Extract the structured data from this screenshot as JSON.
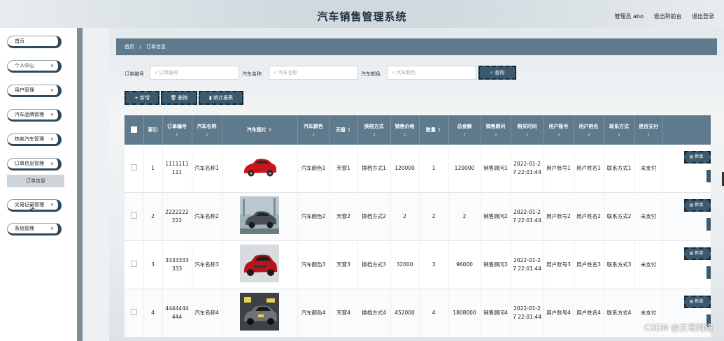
{
  "header": {
    "title": "汽车销售管理系统",
    "admin": "管理员 abo",
    "back_front": "退出到前台",
    "logout": "退出登录"
  },
  "sidebar": {
    "items": [
      {
        "label": "首页"
      },
      {
        "label": "个人中心"
      },
      {
        "label": "用户管理"
      },
      {
        "label": "汽车品牌管理"
      },
      {
        "label": "热卖汽车管理"
      },
      {
        "label": "订单信息管理"
      },
      {
        "label": "交易记录管理"
      },
      {
        "label": "系统管理"
      }
    ],
    "sub_item": "订单信息"
  },
  "breadcrumb": {
    "home": "首页",
    "sep": "/",
    "current": "订单信息"
  },
  "search": {
    "order_label": "订单编号",
    "order_placeholder": "订单编号",
    "car_label": "汽车名称",
    "car_placeholder": "汽车名称",
    "color_label": "汽车颜色",
    "color_placeholder": "汽车颜色",
    "query_button": "查询"
  },
  "actions": {
    "add": "新增",
    "delete": "删除",
    "report": "统计报表"
  },
  "table": {
    "headers": [
      "",
      "索引",
      "订单编号",
      "汽车名称",
      "汽车图片",
      "汽车颜色",
      "天窗",
      "换档方式",
      "销售价格",
      "数量",
      "总金额",
      "销售顾问",
      "购买时间",
      "用户账号",
      "用户姓名",
      "联系方式",
      "是否支付",
      ""
    ],
    "rows": [
      {
        "index": "1",
        "order": "1111111111",
        "name": "汽车名称1",
        "color": "汽车颜色1",
        "sunroof": "天窗1",
        "shift": "换档方式1",
        "price": "120000",
        "qty": "1",
        "total": "120000",
        "advisor": "销售顾问1",
        "time": "2022-01-27 22:01:44",
        "account": "用户账号1",
        "username": "用户姓名1",
        "contact": "联系方式1",
        "paid": "未支付",
        "action": "新增"
      },
      {
        "index": "2",
        "order": "2222222222",
        "name": "汽车名称2",
        "color": "汽车颜色2",
        "sunroof": "天窗2",
        "shift": "换档方式2",
        "price": "2",
        "qty": "2",
        "total": "2",
        "advisor": "销售顾问2",
        "time": "2022-01-27 22:01:44",
        "account": "用户账号2",
        "username": "用户姓名2",
        "contact": "联系方式2",
        "paid": "未支付",
        "action": "新增"
      },
      {
        "index": "3",
        "order": "3333333333",
        "name": "汽车名称3",
        "color": "汽车颜色3",
        "sunroof": "天窗3",
        "shift": "换档方式3",
        "price": "32000",
        "qty": "3",
        "total": "96000",
        "advisor": "销售顾问3",
        "time": "2022-01-27 22:01:44",
        "account": "用户账号3",
        "username": "用户姓名3",
        "contact": "联系方式3",
        "paid": "未支付",
        "action": "新增"
      },
      {
        "index": "4",
        "order": "4444444444",
        "name": "汽车名称4",
        "color": "汽车颜色4",
        "sunroof": "天窗4",
        "shift": "换档方式4",
        "price": "452000",
        "qty": "4",
        "total": "1808000",
        "advisor": "销售顾问4",
        "time": "2022-01-27 22:01:44",
        "account": "用户账号4",
        "username": "用户姓名4",
        "contact": "联系方式4",
        "paid": "未支付",
        "action": "新增"
      }
    ]
  },
  "watermark": "CSDN @文哥网络",
  "colors": {
    "primary": "#5e7a8c",
    "button": "#3c5a6e",
    "rail": "#7d8e97"
  }
}
